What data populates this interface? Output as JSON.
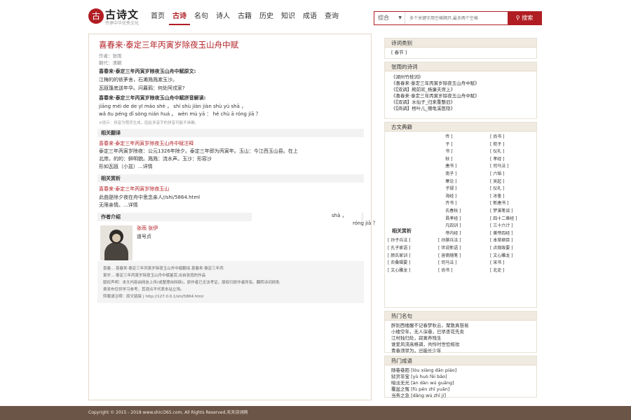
{
  "header": {
    "logo_mark": "古",
    "logo_name": "古诗文",
    "logo_slogan": "传承中华优秀文化",
    "nav": [
      "首页",
      "古诗",
      "名句",
      "诗人",
      "古籍",
      "历史",
      "知识",
      "成语",
      "查询"
    ],
    "nav_active": 1,
    "search_select": "综合",
    "search_placeholder": "多个关键字用空格隔开,最多两个空格",
    "search_button": "搜索"
  },
  "main": {
    "title": "喜春来·泰定三年丙寅岁除夜玉山舟中赋",
    "author_label": "作者：张雨",
    "dynasty_label": "朝代：清朝",
    "original_heading": "喜春来·泰定三年丙寅岁除夜玉山舟中赋原文:",
    "original_lines": [
      "江梅的的依茅舍，石濑溅溅漱玉沙。",
      "瓦瓯篷底送年华。问暮鸦：何处阿戎家?"
    ],
    "pinyin_heading": "喜春来·泰定三年丙寅岁除夜玉山舟中赋拼音解读:",
    "pinyin_lines": [
      "jiāng méi de de yī máo shè ， shí shù jiàn jiàn shù yù shā ，",
      "wǎ ōu péng dǐ sòng nián huá 。 wèn mù yā ： hé chù ā róng jiā ？"
    ],
    "pinyin_note": "※提示：拼音为程序生成，因此多音字的拼音可能不准确。",
    "translation_heading": "相关翻译",
    "translation_link": "喜春来·泰定三年丙寅岁除夜玉山舟中赋注释",
    "translation_lines": [
      "泰定三年丙寅岁除夜：公元1326年除夕。泰定三年即为丙寅年。玉山：今江西玉山县。在上",
      "北岸。的的：鲜明貌。溅溅：流水声。玉沙：形容沙",
      "形如瓦瓯（小盆）...详情"
    ],
    "appreciation_heading": "相关赏析",
    "appreciation_link": "喜春来·泰定三年丙寅岁除夜玉山",
    "appreciation_lines": [
      "此曲是除夕夜在舟中思念亲人//shi/5864.html",
      "无限亲情。...详情"
    ],
    "author_heading": "作者介绍",
    "author_name": "张雨 张伊",
    "author_brief": "道号贞",
    "stray_pinyin_1": "shā ，",
    "stray_pinyin_2": "róng jiā ？",
    "copyright_lines": [
      "喜春... 喜春来·泰定三年丙寅岁除夜玉山舟中赋翻译,喜春来·泰定三年丙",
      "寅岁... 泰定三年丙寅岁除夜玉山舟中赋鉴赏,出自张雨的作品",
      "版权声明：本文内容由网友上传(或整理自网络)，原作者已无法考证，版权归原作者所有。翻转诗词网免",
      "费发布仅供学习参考，其观点不代表本站立场。",
      "转载请注明：原文链接 | http://127.0.0.1/shi/5864.html"
    ]
  },
  "sidebar": {
    "category_title": "诗词类别",
    "category_items": [
      "春节"
    ],
    "poems_title": "张雨的诗词",
    "poems": [
      "《湖州竹枝词》",
      "《喜春来·泰定三年丙寅岁除夜玉山舟中赋》",
      "《【双调】殿前欢_杨廉夫席上》",
      "《喜春来·泰定三年丙寅岁除夜玉山舟中赋》",
      "《【双调】水仙子_归来重整旧》",
      "《【商调】梧叶儿_赠龟溪医隐》"
    ],
    "classics_title": "古文典籍",
    "related_appreciation": "相关赏析",
    "tags": [
      "周易",
      "易传",
      "尚书",
      "礼记",
      "荀子",
      "荀子",
      "列子",
      "宋书",
      "仪礼",
      "周书",
      "春秋",
      "孝经",
      "北齐书",
      "新唐书",
      "司马法",
      "水经注",
      "淮南子",
      "六韬",
      "千字文",
      "伤寒论",
      "吴起",
      "菜根谭",
      "弟子规",
      "仪礼",
      "韩非子",
      "山海经",
      "冰鉴",
      "围炉夜话",
      "北齐书",
      "新唐书",
      "资治通鉴",
      "吕氏春秋",
      "梦溪笔谈",
      "旧五代史",
      "文昌孝经",
      "四十二章经",
      "吕氏春秋",
      "了凡四训",
      "三十六计",
      "徐霞客游记",
      "黄帝内经",
      "黄帝四经",
      "孙子兵法",
      "孙膑兵法",
      "本草纲目",
      "孔子家语",
      "世说新语",
      "贞观政要",
      "颜氏家训",
      "容斋随笔",
      "文心雕龙",
      "农桑辑要",
      "司马法",
      "宋书",
      "文心雕龙",
      "尚书",
      "北史"
    ],
    "famous_title": "热门名句",
    "famous": [
      "醉别西楼醒不记春梦秋云，聚散真容易",
      "小楼空年，无人深巷，已早杏花先卖",
      "江村独归处，寂寞养残生",
      "谁爱风流高格调，共怜时世俭梳妆",
      "青春须早为，岂能长少年"
    ],
    "idioms_title": "热门成语",
    "idioms": [
      "随巷巷陌 [lòu xiàng dān piáo]",
      "狱货非宝 [yù huò fēi bǎo]",
      "暗淡无光 [àn dàn wú guāng]",
      "覆盆之冤 [fù pén zhī yuān]",
      "当务之急 [dāng wù zhī jí]"
    ]
  },
  "footer": {
    "text": "Copyright © 2015 - 2018 www.shici365.com, All Rights Reserved.天天诗词网"
  }
}
